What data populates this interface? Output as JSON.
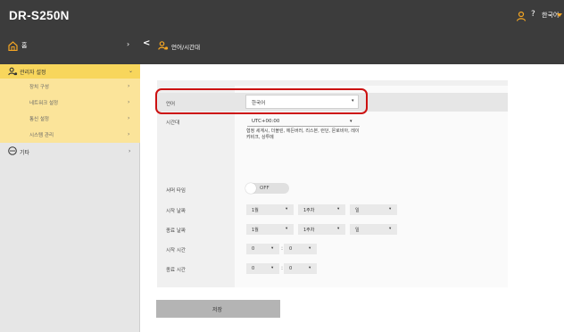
{
  "app": {
    "title": "DR-S250N"
  },
  "topbar": {
    "help": "?",
    "language": "한국어"
  },
  "nav": {
    "home_label": "홈",
    "arrow": "›",
    "back": "<",
    "page_label": "언어/시간대"
  },
  "sidebar": {
    "admin_label": "관리자 설정",
    "admin_chevron": "⌄",
    "subitems": [
      {
        "label": "장치 구성",
        "chevron": "›"
      },
      {
        "label": "네트워크 설정",
        "chevron": "›"
      },
      {
        "label": "통신 설정",
        "chevron": "›"
      },
      {
        "label": "시스템 관리",
        "chevron": "›"
      }
    ],
    "other_label": "기타",
    "other_chevron": "›"
  },
  "form": {
    "language_label": "언어",
    "language_value": "한국어",
    "timezone_label": "시간대",
    "timezone_value": "UTC+00:00",
    "timezone_desc": "협정 세계시, 더블린, 에든버러, 리스본, 런던, 몬로비아, 레이캬비크, 상투메",
    "dst_label": "서머 타임",
    "dst_toggle": "OFF",
    "start_date_label": "시작 날짜",
    "end_date_label": "종료 날짜",
    "start_time_label": "시작 시간",
    "end_time_label": "종료 시간",
    "month_value": "1월",
    "week_value": "1주차",
    "day_value": "일",
    "hour_value": "0",
    "minute_value": "0",
    "colon": ":",
    "dropdown": "▾",
    "save_label": "저장"
  },
  "colors": {
    "header": "#3c3c3c",
    "accent": "#f5a623",
    "sidebar_active": "#f8d65c",
    "sidebar_sub": "#fbe49a",
    "highlight": "#cc1111"
  },
  "icons": [
    "user-icon",
    "home-icon",
    "admin-settings-icon",
    "more-icon"
  ]
}
